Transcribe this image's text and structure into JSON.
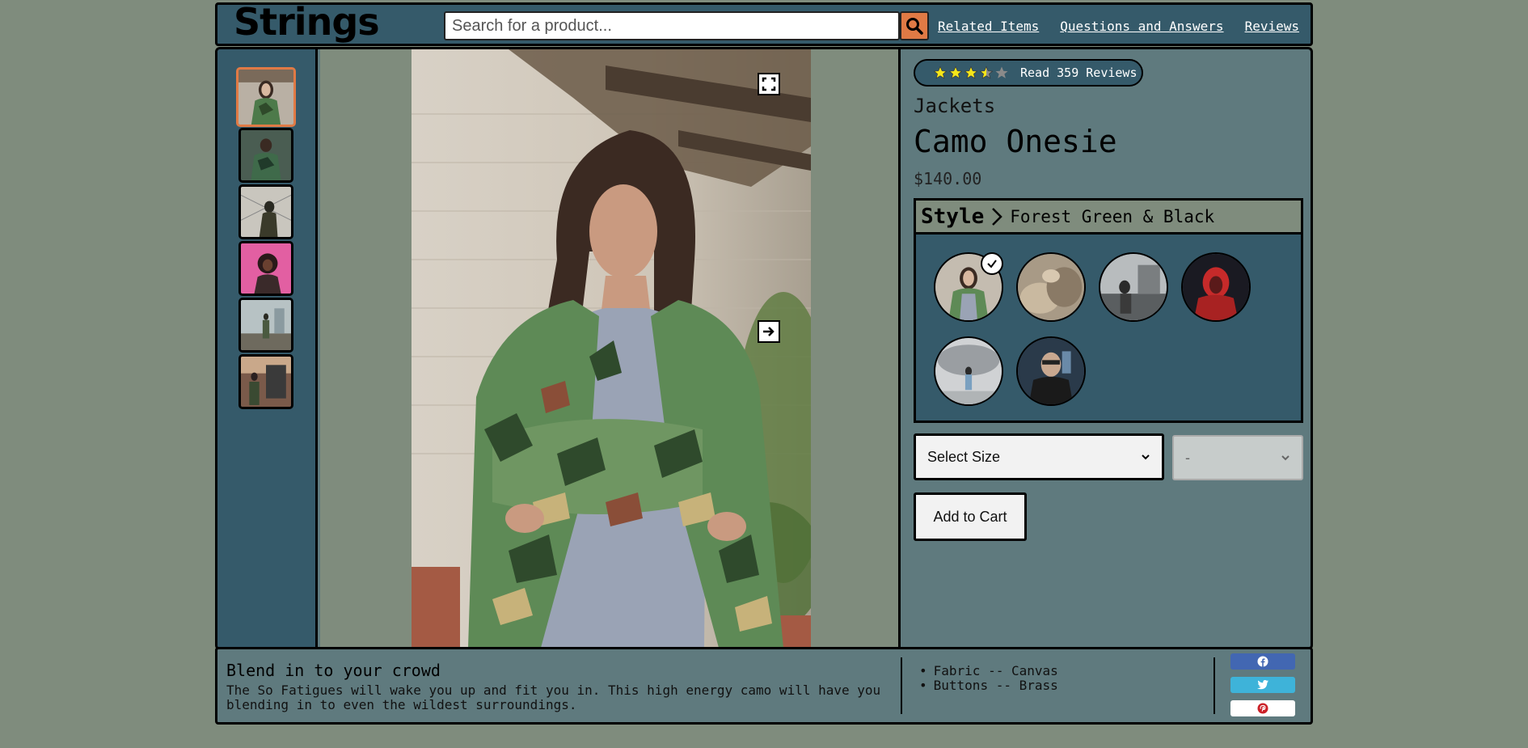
{
  "header": {
    "logo": "Strings",
    "search_placeholder": "Search for a product...",
    "nav": [
      {
        "label": "Related Items"
      },
      {
        "label": "Questions and Answers"
      },
      {
        "label": "Reviews"
      }
    ]
  },
  "overview": {
    "rating": 3.5,
    "rating_max": 5,
    "read_reviews_label": "Read 359 Reviews",
    "category": "Jackets",
    "product_name": "Camo Onesie",
    "price": "$140.00",
    "style_label": "Style",
    "selected_style_name": "Forest Green & Black",
    "size_select": {
      "selected": "Select Size"
    },
    "quantity_select": {
      "selected": "-"
    },
    "add_to_cart_label": "Add to Cart"
  },
  "gallery": {
    "thumbnail_count": 6,
    "active_thumbnail": 1
  },
  "styles": [
    {
      "selected": true
    },
    {
      "selected": false
    },
    {
      "selected": false
    },
    {
      "selected": false
    },
    {
      "selected": false
    },
    {
      "selected": false
    }
  ],
  "footer": {
    "slogan": "Blend in to your crowd",
    "description_line1": "The So Fatigues will wake you up and fit you in. This high energy camo will have you",
    "description_line2": "blending in to even the wildest surroundings.",
    "features": [
      "Fabric -- Canvas",
      "Buttons -- Brass"
    ],
    "share": [
      {
        "icon": "facebook-icon",
        "color": "#4267b2"
      },
      {
        "icon": "twitter-icon",
        "color": "#3eb3d9"
      },
      {
        "icon": "pinterest-icon",
        "color": "#ffffff"
      }
    ]
  },
  "colors": {
    "background": "#7f8c7d",
    "panel": "#355a6a",
    "info_panel": "#5f7a7e",
    "accent": "#e07a45",
    "star_filled": "#f5e61a",
    "star_empty": "#8a8a8a"
  }
}
